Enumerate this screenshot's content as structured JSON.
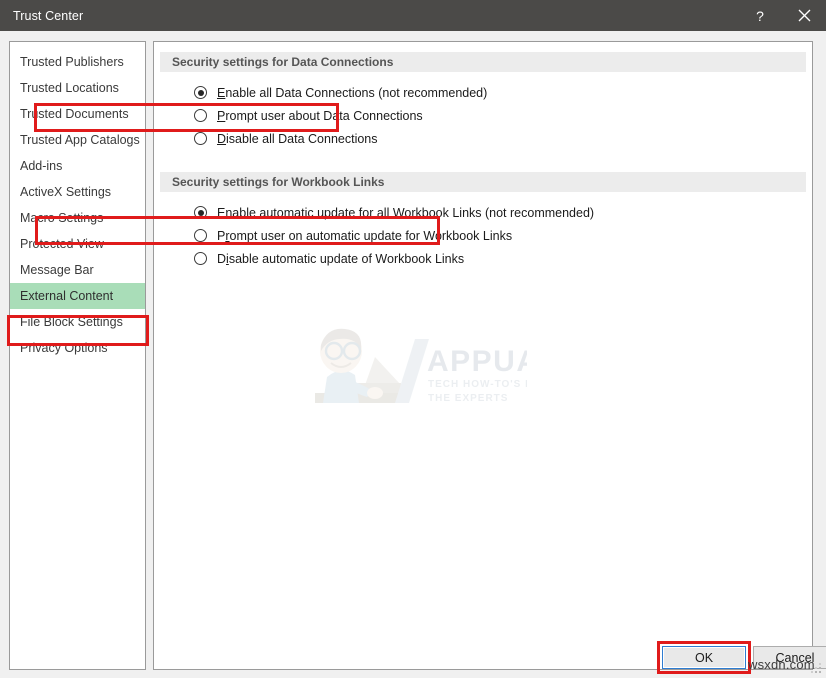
{
  "window": {
    "title": "Trust Center",
    "help_icon": "question-mark-icon",
    "close_icon": "close-icon",
    "help_label": "?",
    "close_label": "✕"
  },
  "sidebar": {
    "items": [
      {
        "label": "Trusted Publishers",
        "selected": false
      },
      {
        "label": "Trusted Locations",
        "selected": false
      },
      {
        "label": "Trusted Documents",
        "selected": false
      },
      {
        "label": "Trusted App Catalogs",
        "selected": false
      },
      {
        "label": "Add-ins",
        "selected": false
      },
      {
        "label": "ActiveX Settings",
        "selected": false
      },
      {
        "label": "Macro Settings",
        "selected": false
      },
      {
        "label": "Protected View",
        "selected": false
      },
      {
        "label": "Message Bar",
        "selected": false
      },
      {
        "label": "External Content",
        "selected": true
      },
      {
        "label": "File Block Settings",
        "selected": false
      },
      {
        "label": "Privacy Options",
        "selected": false
      }
    ]
  },
  "main": {
    "sections": [
      {
        "header": "Security settings for Data Connections",
        "options": [
          {
            "pre": "",
            "acc": "E",
            "post": "nable all Data Connections (not recommended)",
            "full": "Enable all Data Connections (not recommended)",
            "checked": true,
            "highlighted": true
          },
          {
            "pre": "",
            "acc": "P",
            "post": "rompt user about Data Connections",
            "full": "Prompt user about Data Connections",
            "checked": false,
            "highlighted": false
          },
          {
            "pre": "",
            "acc": "D",
            "post": "isable all Data Connections",
            "full": "Disable all Data Connections",
            "checked": false,
            "highlighted": false
          }
        ]
      },
      {
        "header": "Security settings for Workbook Links",
        "options": [
          {
            "pre": "Enable ",
            "acc": "a",
            "post": "utomatic update for all Workbook Links (not recommended)",
            "full": "Enable automatic update for all Workbook Links (not recommended)",
            "checked": true,
            "highlighted": true
          },
          {
            "pre": "P",
            "acc": "r",
            "post": "ompt user on automatic update for Workbook Links",
            "full": "Prompt user on automatic update for Workbook Links",
            "checked": false,
            "highlighted": false
          },
          {
            "pre": "D",
            "acc": "i",
            "post": "sable automatic update of Workbook Links",
            "full": "Disable automatic update of Workbook Links",
            "checked": false,
            "highlighted": false
          }
        ]
      }
    ]
  },
  "watermark": {
    "brand": "APPUALS",
    "tagline_line1": "TECH HOW-TO'S FROM",
    "tagline_line2": "THE EXPERTS"
  },
  "footer": {
    "ok_label": "OK",
    "cancel_label": "Cancel",
    "site_watermark": "wsxdn.com"
  },
  "colors": {
    "titlebar": "#4b4a48",
    "annotation_red": "#e01b1b",
    "selection_green": "#a9ddb8",
    "section_header_bg": "#ececec",
    "focus_blue": "#2f7dd1"
  }
}
